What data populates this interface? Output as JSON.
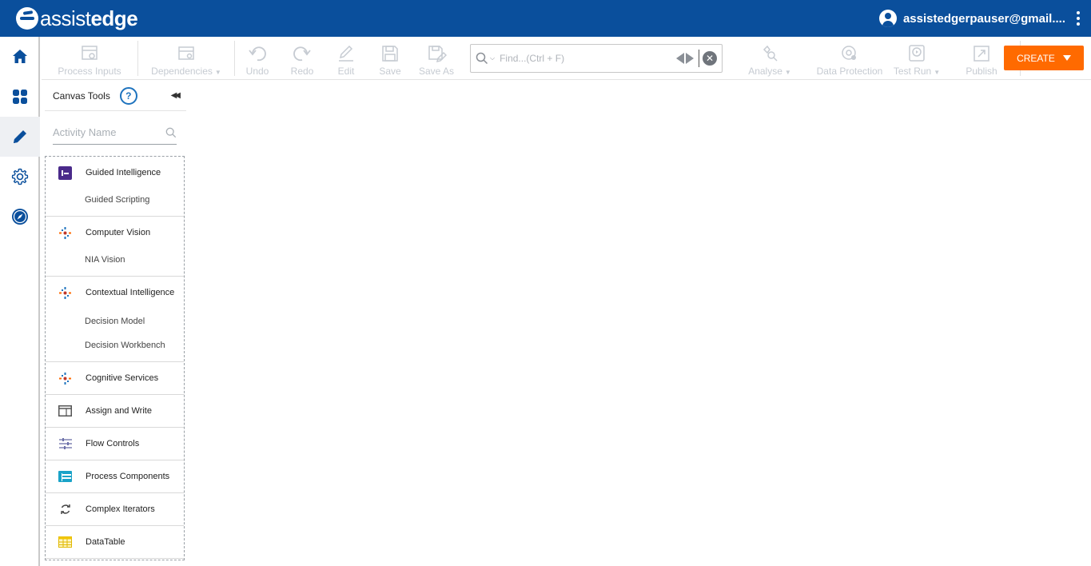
{
  "header": {
    "logo_light": "assist",
    "logo_bold": "edge",
    "user_email": "assistedgerpauser@gmail...."
  },
  "nav": {
    "items": [
      {
        "name": "home-icon"
      },
      {
        "name": "dashboard-icon"
      },
      {
        "name": "pencil-icon"
      },
      {
        "name": "gear-icon"
      },
      {
        "name": "compass-icon"
      }
    ]
  },
  "toolbar": {
    "process_inputs": "Process Inputs",
    "dependencies": "Dependencies",
    "undo": "Undo",
    "redo": "Redo",
    "edit": "Edit",
    "save": "Save",
    "save_as": "Save As",
    "find_placeholder": "Find...(Ctrl + F)",
    "analyse": "Analyse",
    "data_protection": "Data Protection",
    "test_run": "Test Run",
    "publish": "Publish",
    "create": "CREATE"
  },
  "panel": {
    "title": "Canvas Tools",
    "help": "?",
    "search_placeholder": "Activity Name",
    "groups": [
      {
        "label": "Guided Intelligence",
        "icon": "guided-intelligence-icon",
        "subs": [
          "Guided Scripting"
        ]
      },
      {
        "label": "Computer Vision",
        "icon": "computer-vision-icon",
        "subs": [
          "NIA Vision"
        ]
      },
      {
        "label": "Contextual Intelligence",
        "icon": "contextual-intelligence-icon",
        "subs": [
          "Decision Model",
          "Decision Workbench"
        ]
      },
      {
        "label": "Cognitive Services",
        "icon": "cognitive-services-icon",
        "subs": []
      },
      {
        "label": "Assign and Write",
        "icon": "assign-write-icon",
        "subs": []
      },
      {
        "label": "Flow Controls",
        "icon": "flow-controls-icon",
        "subs": []
      },
      {
        "label": "Process Components",
        "icon": "process-components-icon",
        "subs": []
      },
      {
        "label": "Complex Iterators",
        "icon": "complex-iterators-icon",
        "subs": []
      },
      {
        "label": "DataTable",
        "icon": "datatable-icon",
        "subs": []
      }
    ]
  },
  "colors": {
    "header_bg": "#0a4f9c",
    "create_bg": "#ff6a00",
    "accent": "#1e73be"
  }
}
